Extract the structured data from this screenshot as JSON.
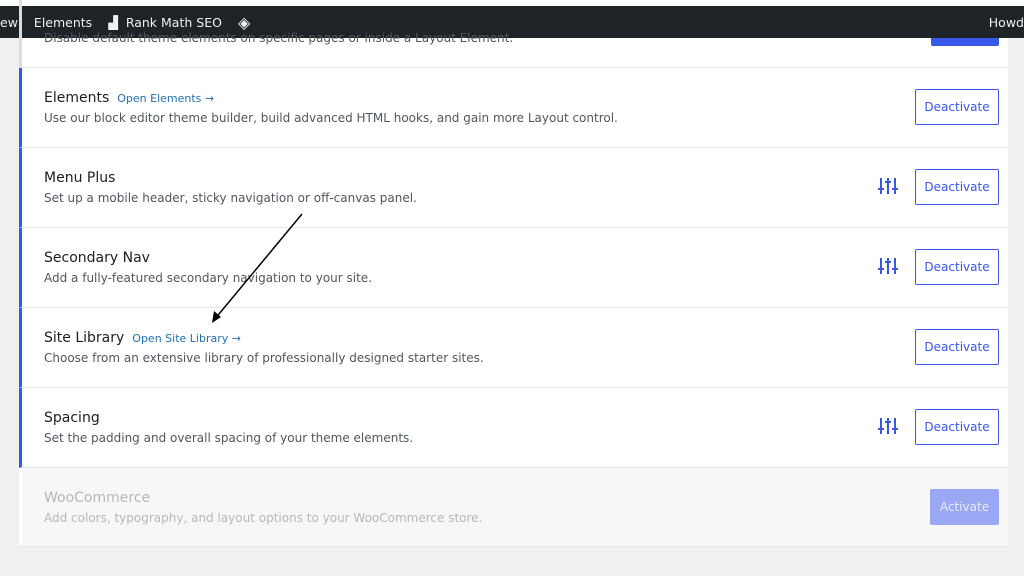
{
  "adminbar": {
    "items": [
      "ew",
      "Elements",
      "Rank Math SEO"
    ],
    "howdy": "Howd"
  },
  "modules": [
    {
      "title": "",
      "desc": "Disable default theme elements on specific pages or inside a Layout Element."
    },
    {
      "title": "Elements",
      "link": "Open Elements →",
      "desc": "Use our block editor theme builder, build advanced HTML hooks, and gain more Layout control.",
      "button": "Deactivate"
    },
    {
      "title": "Menu Plus",
      "desc": "Set up a mobile header, sticky navigation or off-canvas panel.",
      "button": "Deactivate",
      "settings": true
    },
    {
      "title": "Secondary Nav",
      "desc": "Add a fully-featured secondary navigation to your site.",
      "button": "Deactivate",
      "settings": true
    },
    {
      "title": "Site Library",
      "link": "Open Site Library →",
      "desc": "Choose from an extensive library of professionally designed starter sites.",
      "button": "Deactivate"
    },
    {
      "title": "Spacing",
      "desc": "Set the padding and overall spacing of your theme elements.",
      "button": "Deactivate",
      "settings": true
    },
    {
      "title": "WooCommerce",
      "desc": "Add colors, typography, and layout options to your WooCommerce store.",
      "button": "Activate",
      "disabled": true
    }
  ],
  "colors": {
    "accent": "#3858e9",
    "adminbar": "#1d2327",
    "link": "#2271b1"
  }
}
